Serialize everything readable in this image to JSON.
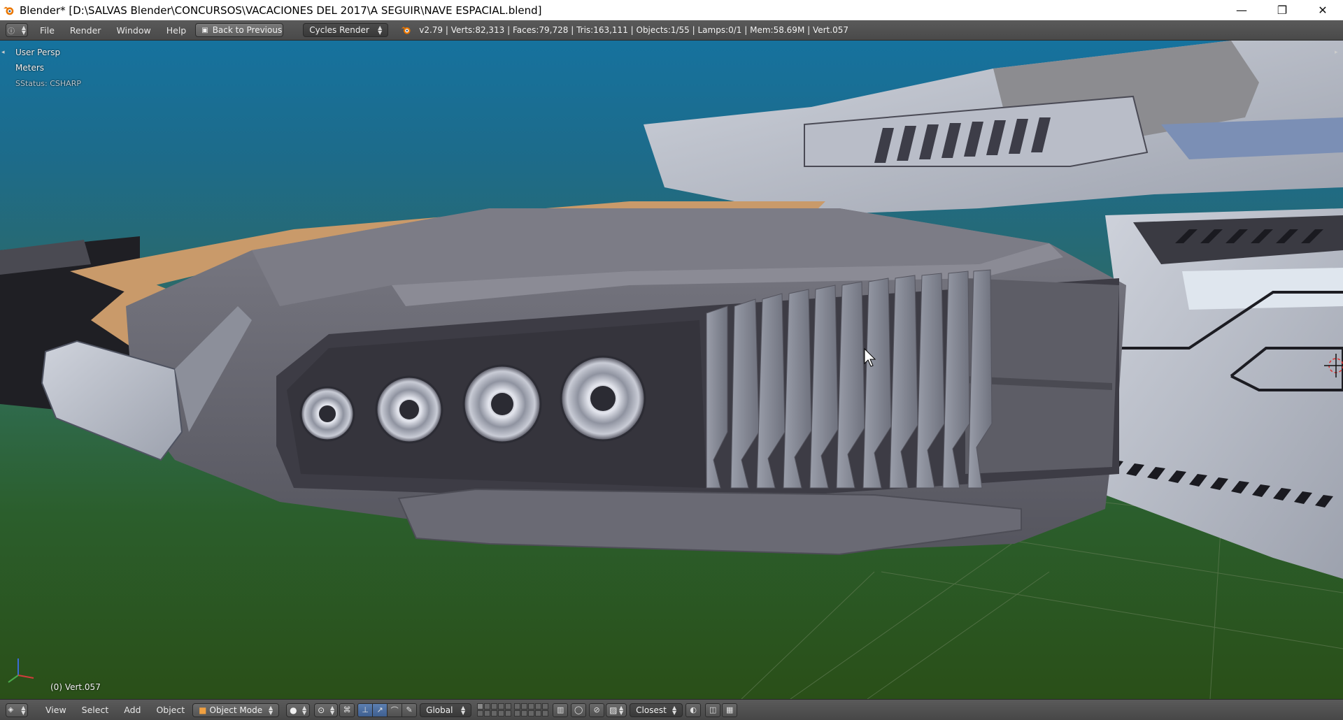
{
  "window": {
    "title": "Blender* [D:\\SALVAS Blender\\CONCURSOS\\VACACIONES DEL 2017\\A SEGUIR\\NAVE ESPACIAL.blend]",
    "minimize": "—",
    "maximize": "❐",
    "close": "✕"
  },
  "infobar": {
    "menus": [
      "File",
      "Render",
      "Window",
      "Help"
    ],
    "back_button": "Back to Previous",
    "render_engine": "Cycles Render",
    "stats": "v2.79 | Verts:82,313 | Faces:79,728 | Tris:163,111 | Objects:1/55 | Lamps:0/1 | Mem:58.69M | Vert.057"
  },
  "viewport": {
    "view_name": "User Persp",
    "units": "Meters",
    "status": "SStatus: CSHARP",
    "object_label": "(0) Vert.057"
  },
  "bottombar": {
    "menus": [
      "View",
      "Select",
      "Add",
      "Object"
    ],
    "mode": "Object Mode",
    "orientation": "Global",
    "snap_target": "Closest"
  },
  "colors": {
    "accent": "#5c7fb0",
    "hull_tan": "#c99a6a",
    "hull_gray": "#6e6e78"
  }
}
